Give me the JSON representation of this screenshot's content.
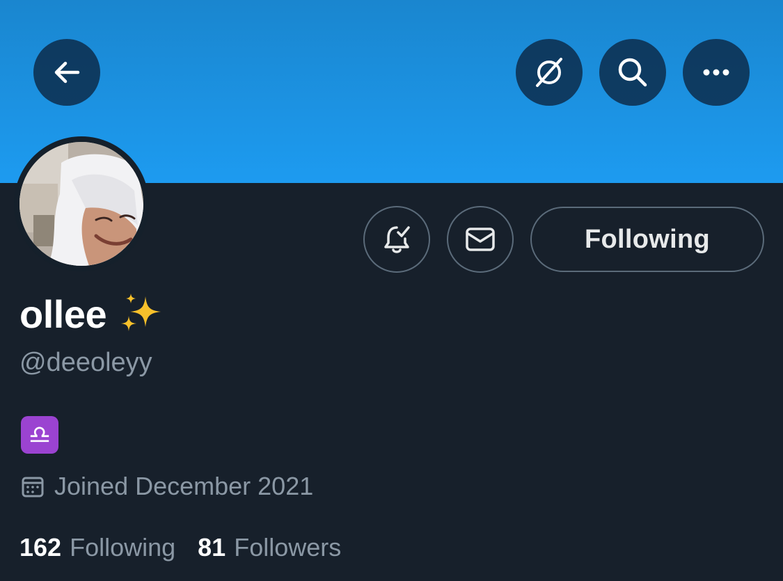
{
  "profile": {
    "display_name": "ollee",
    "handle": "@deeoleyy",
    "bio_emoji": "♎",
    "joined": "Joined December 2021"
  },
  "actions": {
    "follow_state_label": "Following"
  },
  "stats": [
    {
      "count": "162",
      "label": "Following"
    },
    {
      "count": "81",
      "label": "Followers"
    }
  ],
  "icons": {
    "back": "back-arrow-icon",
    "explore": "compass-icon",
    "search": "search-icon",
    "more": "more-icon",
    "notifications": "bell-check-icon",
    "message": "envelope-icon",
    "calendar": "calendar-icon"
  },
  "colors": {
    "banner": "#1d9bf0",
    "background": "#15202b",
    "secondary_text": "#8b98a5",
    "libra_badge": "#9b43d1"
  }
}
